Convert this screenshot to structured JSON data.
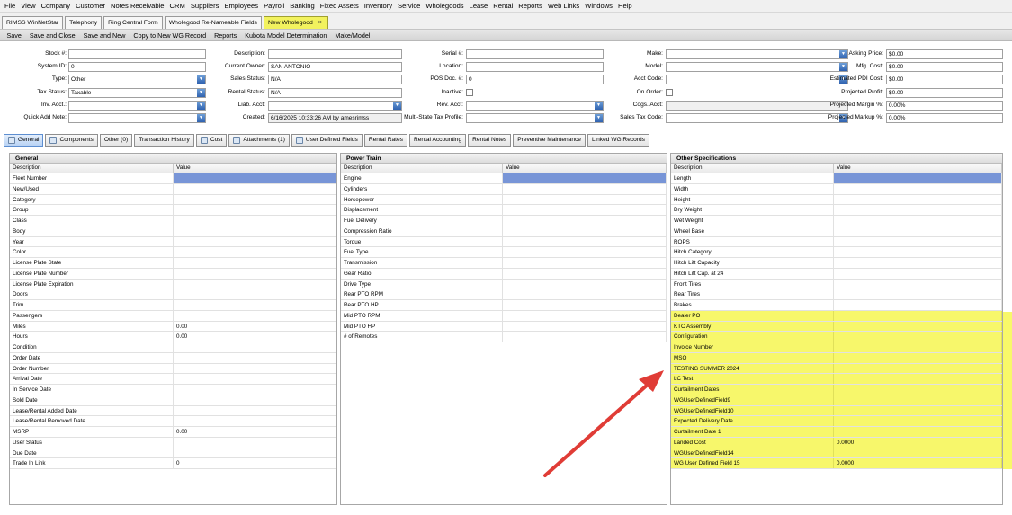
{
  "menu": [
    "File",
    "View",
    "Company",
    "Customer",
    "Notes Receivable",
    "CRM",
    "Suppliers",
    "Employees",
    "Payroll",
    "Banking",
    "Fixed Assets",
    "Inventory",
    "Service",
    "Wholegoods",
    "Lease",
    "Rental",
    "Reports",
    "Web Links",
    "Windows",
    "Help"
  ],
  "doc_tabs": [
    {
      "label": "RIMSS WinNetStar",
      "active": false
    },
    {
      "label": "Telephony",
      "active": false
    },
    {
      "label": "Ring Central Form",
      "active": false
    },
    {
      "label": "Wholegood Re-Nameable Fields",
      "active": false
    },
    {
      "label": "New Wholegood",
      "active": true,
      "close": "×"
    }
  ],
  "toolbar": [
    "Save",
    "Save and Close",
    "Save and New",
    "Copy to New WG Record",
    "Reports",
    "Kubota Model Determination",
    "Make/Model"
  ],
  "form": {
    "col1": [
      {
        "label": "Stock #:",
        "value": "",
        "type": "text"
      },
      {
        "label": "System ID:",
        "value": "0",
        "type": "text"
      },
      {
        "label": "Type:",
        "value": "Other",
        "type": "select"
      },
      {
        "label": "Tax Status:",
        "value": "Taxable",
        "type": "select"
      },
      {
        "label": "Inv. Acct.:",
        "value": "",
        "type": "select"
      },
      {
        "label": "Quick Add Note:",
        "value": "",
        "type": "select"
      }
    ],
    "col2": [
      {
        "label": "Description:",
        "value": "",
        "type": "text"
      },
      {
        "label": "Current Owner:",
        "value": "SAN ANTONIO",
        "type": "text"
      },
      {
        "label": "Sales Status:",
        "value": "N/A",
        "type": "text"
      },
      {
        "label": "Rental Status:",
        "value": "N/A",
        "type": "text"
      },
      {
        "label": "Liab. Acct:",
        "value": "",
        "type": "select"
      },
      {
        "label": "Created:",
        "value": "6/16/2025 10:33:26 AM by amesrimss",
        "type": "readonly"
      }
    ],
    "col3": [
      {
        "label": "Serial #:",
        "value": "",
        "type": "text"
      },
      {
        "label": "Location:",
        "value": "",
        "type": "text"
      },
      {
        "label": "POS Doc. #:",
        "value": "0",
        "type": "text"
      },
      {
        "label": "Inactive:",
        "value": "",
        "type": "checkbox"
      },
      {
        "label": "Rev. Acct:",
        "value": "",
        "type": "select"
      },
      {
        "label": "Multi-State Tax Profile:",
        "value": "",
        "type": "select"
      }
    ],
    "col4": [
      {
        "label": "Make:",
        "value": "",
        "type": "select"
      },
      {
        "label": "Model:",
        "value": "",
        "type": "select"
      },
      {
        "label": "Acct Code:",
        "value": "",
        "type": "select"
      },
      {
        "label": "On Order:",
        "value": "",
        "type": "checkbox"
      },
      {
        "label": "Cogs. Acct:",
        "value": "",
        "type": "readonly"
      },
      {
        "label": "Sales Tax Code:",
        "value": "",
        "type": "select"
      }
    ],
    "col5": [
      {
        "label": "Asking Price:",
        "value": "$0.00",
        "type": "text"
      },
      {
        "label": "Mfg. Cost:",
        "value": "$0.00",
        "type": "text"
      },
      {
        "label": "Estimated PDI Cost:",
        "value": "$0.00",
        "type": "text"
      },
      {
        "label": "Projected Profit:",
        "value": "$0.00",
        "type": "text"
      },
      {
        "label": "Projected Margin %:",
        "value": "0.00%",
        "type": "text"
      },
      {
        "label": "Projected Markup %:",
        "value": "0.00%",
        "type": "text"
      }
    ]
  },
  "sub_tabs": [
    {
      "label": "General",
      "active": true,
      "icon": "info-icon"
    },
    {
      "label": "Components",
      "icon": "components-icon"
    },
    {
      "label": "Other (0)"
    },
    {
      "label": "Transaction History"
    },
    {
      "label": "Cost",
      "icon": "cost-icon"
    },
    {
      "label": "Attachments (1)",
      "icon": "attachment-icon"
    },
    {
      "label": "User Defined Fields",
      "icon": "user-defined-icon"
    },
    {
      "label": "Rental Rates"
    },
    {
      "label": "Rental Accounting"
    },
    {
      "label": "Rental Notes"
    },
    {
      "label": "Preventive Maintenance"
    },
    {
      "label": "Linked WG Records"
    }
  ],
  "panels": [
    {
      "title": "General",
      "col_desc": "Description",
      "col_val": "Value",
      "rows": [
        [
          "Fleet Number",
          ""
        ],
        [
          "New/Used",
          ""
        ],
        [
          "Category",
          ""
        ],
        [
          "Group",
          ""
        ],
        [
          "Class",
          ""
        ],
        [
          "Body",
          ""
        ],
        [
          "Year",
          ""
        ],
        [
          "Color",
          ""
        ],
        [
          "License Plate State",
          ""
        ],
        [
          "License Plate Number",
          ""
        ],
        [
          "License Plate Expiration",
          ""
        ],
        [
          "Doors",
          ""
        ],
        [
          "Trim",
          ""
        ],
        [
          "Passengers",
          ""
        ],
        [
          "Miles",
          "0.00"
        ],
        [
          "Hours",
          "0.00"
        ],
        [
          "Condition",
          ""
        ],
        [
          "Order Date",
          ""
        ],
        [
          "Order Number",
          ""
        ],
        [
          "Arrival Date",
          ""
        ],
        [
          "In Service Date",
          ""
        ],
        [
          "Sold Date",
          ""
        ],
        [
          "Lease/Rental Added Date",
          ""
        ],
        [
          "Lease/Rental Removed Date",
          ""
        ],
        [
          "MSRP",
          "0.00"
        ],
        [
          "User Status",
          ""
        ],
        [
          "Due Date",
          ""
        ],
        [
          "Trade In Link",
          "0"
        ]
      ]
    },
    {
      "title": "Power Train",
      "col_desc": "Description",
      "col_val": "Value",
      "rows": [
        [
          "Engine",
          ""
        ],
        [
          "Cylinders",
          ""
        ],
        [
          "Horsepower",
          ""
        ],
        [
          "Displacement",
          ""
        ],
        [
          "Fuel Delivery",
          ""
        ],
        [
          "Compression Ratio",
          ""
        ],
        [
          "Torque",
          ""
        ],
        [
          "Fuel Type",
          ""
        ],
        [
          "Transmission",
          ""
        ],
        [
          "Gear Ratio",
          ""
        ],
        [
          "Drive Type",
          ""
        ],
        [
          "Rear PTO RPM",
          ""
        ],
        [
          "Rear PTO HP",
          ""
        ],
        [
          "Mid PTO RPM",
          ""
        ],
        [
          "Mid PTO HP",
          ""
        ],
        [
          "# of Remotes",
          ""
        ]
      ]
    },
    {
      "title": "Other Specifications",
      "col_desc": "Description",
      "col_val": "Value",
      "rows": [
        [
          "Length",
          ""
        ],
        [
          "Width",
          ""
        ],
        [
          "Height",
          ""
        ],
        [
          "Dry Weight",
          ""
        ],
        [
          "Wet Weight",
          ""
        ],
        [
          "Wheel Base",
          ""
        ],
        [
          "ROPS",
          ""
        ],
        [
          "Hitch Category",
          ""
        ],
        [
          "Hitch Lift Capacity",
          ""
        ],
        [
          "Hitch Lift Cap. at 24",
          ""
        ],
        [
          "Front Tires",
          ""
        ],
        [
          "Rear Tires",
          ""
        ],
        [
          "Brakes",
          ""
        ],
        [
          "Dealer PO",
          ""
        ],
        [
          "KTC Assembly",
          ""
        ],
        [
          "Configuration",
          ""
        ],
        [
          "Invoice Number",
          ""
        ],
        [
          "MSO",
          ""
        ],
        [
          "TESTING SUMMER 2024",
          ""
        ],
        [
          "LC Test",
          ""
        ],
        [
          "Curtailment Dates",
          ""
        ],
        [
          "WGUserDefinedField9",
          ""
        ],
        [
          "WGUserDefinedField10",
          ""
        ],
        [
          "Expected Delivery Date",
          ""
        ],
        [
          "Curtailment Date 1",
          ""
        ],
        [
          "Landed Cost",
          "0.0000"
        ],
        [
          "WGUserDefinedField14",
          ""
        ],
        [
          "WG User Defined Field 15",
          "0.0000"
        ]
      ]
    }
  ],
  "colors": {
    "highlight": "#f7f74f",
    "arrow": "#e03c36",
    "selected": "#7895d7",
    "active_doc_tab": "#f2f25e"
  }
}
